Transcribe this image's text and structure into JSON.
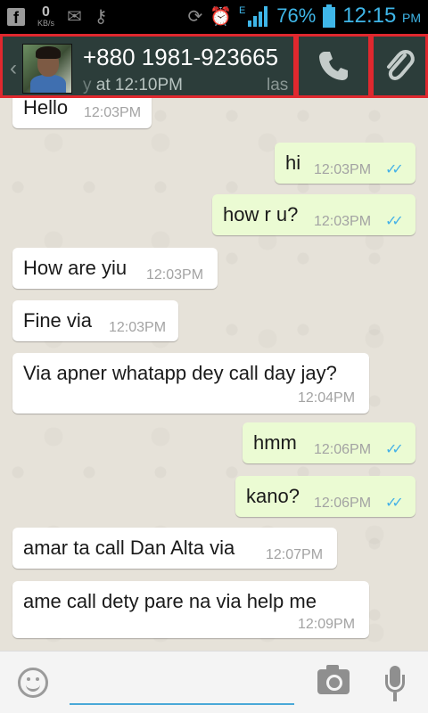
{
  "status_bar": {
    "fb_icon": "facebook-notification-icon",
    "speed_value": "0",
    "speed_unit": "KB/s",
    "network_type": "E",
    "battery_percent": "76%",
    "time": "12:15",
    "ampm": "PM"
  },
  "header": {
    "contact_name": "+880 1981-923665",
    "last_seen_prefix": "y",
    "last_seen": " at 12:10PM",
    "last_seen_tail": "las"
  },
  "messages": [
    {
      "direction": "in",
      "text": "Hello",
      "time": "12:03PM"
    },
    {
      "direction": "out",
      "text": "hi",
      "time": "12:03PM",
      "ticks": "✓✓"
    },
    {
      "direction": "out",
      "text": "how r u?",
      "time": "12:03PM",
      "ticks": "✓✓"
    },
    {
      "direction": "in",
      "text": "How are yiu",
      "time": "12:03PM"
    },
    {
      "direction": "in",
      "text": "Fine via",
      "time": "12:03PM"
    },
    {
      "direction": "in",
      "text": "Via apner whatapp dey call day jay?",
      "time": "12:04PM"
    },
    {
      "direction": "out",
      "text": "hmm",
      "time": "12:06PM",
      "ticks": "✓✓"
    },
    {
      "direction": "out",
      "text": "kano?",
      "time": "12:06PM",
      "ticks": "✓✓"
    },
    {
      "direction": "in",
      "text": "amar ta call Dan Alta via",
      "time": "12:07PM"
    },
    {
      "direction": "in",
      "text": "ame call dety pare na via help me",
      "time": "12:09PM"
    }
  ],
  "input_bar": {
    "placeholder": ""
  },
  "colors": {
    "action_bar": "#2c3d3a",
    "incoming_bubble": "#ffffff",
    "outgoing_bubble": "#ebfbd3",
    "read_ticks": "#45b1e7",
    "highlight_box": "#e0282e",
    "status_accent": "#3fb6e8"
  }
}
